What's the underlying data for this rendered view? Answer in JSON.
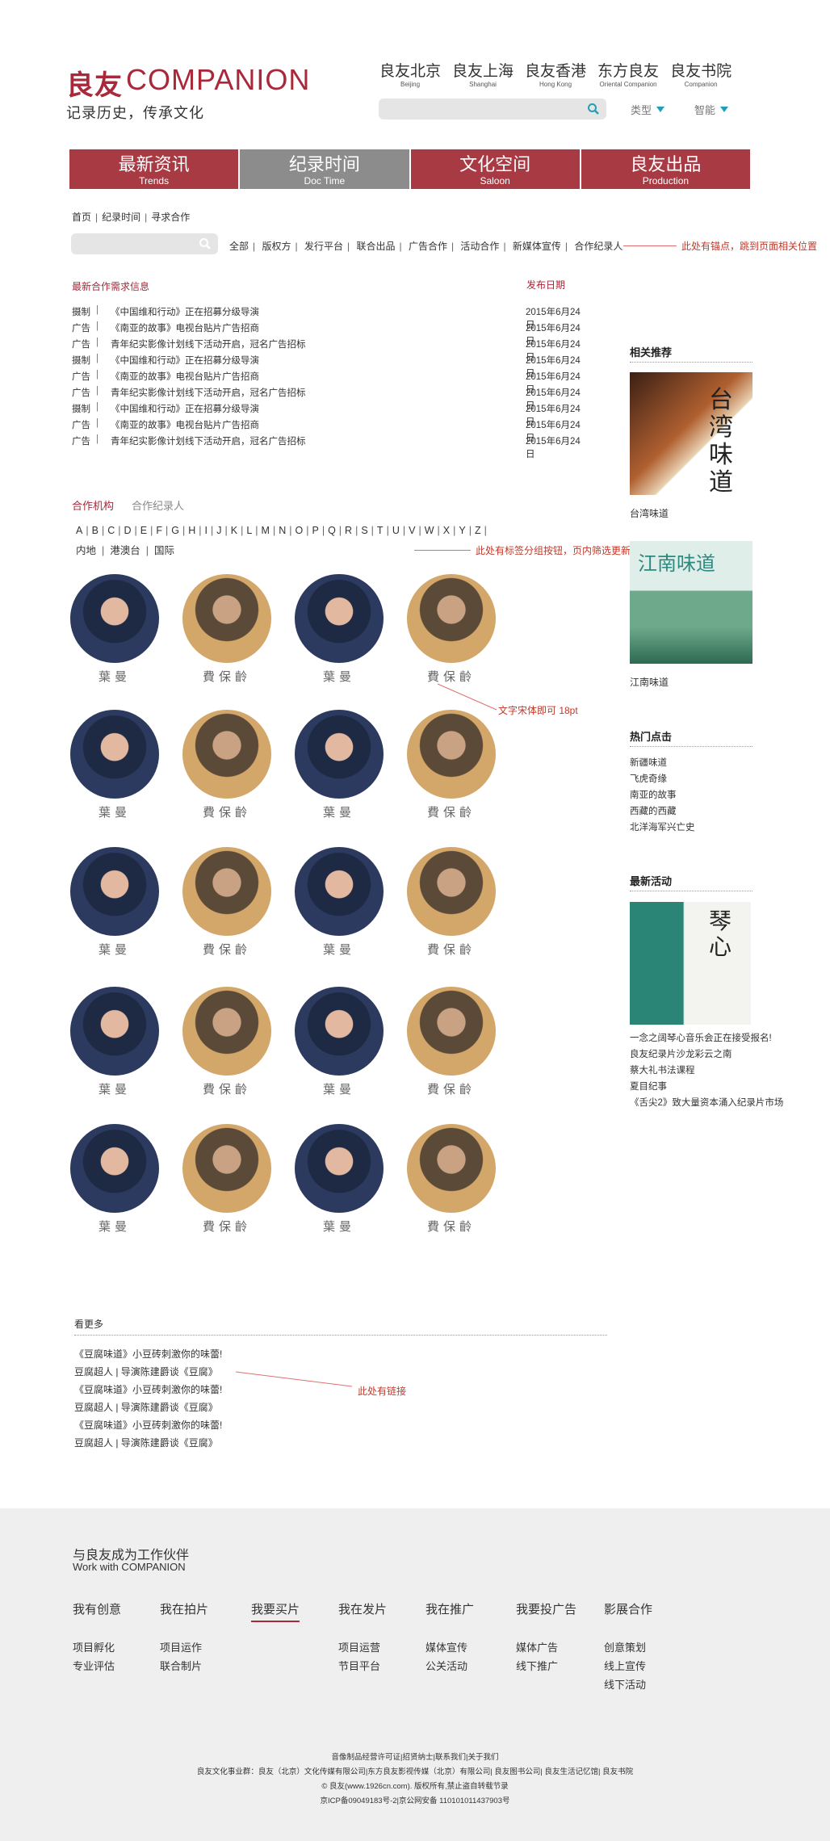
{
  "header": {
    "logo_cn": "良友",
    "logo_en": "COMPANION",
    "slogan": "记录历史，传承文化",
    "brands": [
      {
        "cn": "良友北京",
        "en": "Beijing"
      },
      {
        "cn": "良友上海",
        "en": "Shanghai"
      },
      {
        "cn": "良友香港",
        "en": "Hong Kong"
      },
      {
        "cn": "东方良友",
        "en": "Oriental Companion"
      },
      {
        "cn": "良友书院",
        "en": "Companion"
      }
    ],
    "search_placeholder": "",
    "filter_type": "类型",
    "filter_smart": "智能"
  },
  "nav": [
    {
      "cn": "最新资讯",
      "en": "Trends"
    },
    {
      "cn": "纪录时间",
      "en": "Doc Time"
    },
    {
      "cn": "文化空间",
      "en": "Saloon"
    },
    {
      "cn": "良友出品",
      "en": "Production"
    }
  ],
  "breadcrumb": [
    "首页",
    "纪录时间",
    "寻求合作"
  ],
  "categories": [
    "全部",
    "版权方",
    "发行平台",
    "联合出品",
    "广告合作",
    "活动合作",
    "新媒体宣传",
    "合作纪录人"
  ],
  "notes": {
    "anchor": "此处有锚点，跳到页面相关位置",
    "tags": "此处有标签分组按钮，页内筛选更新",
    "font": "文字宋体即可 18pt",
    "links": "此处有链接"
  },
  "info_list": {
    "heading": "最新合作需求信息",
    "date_heading": "发布日期",
    "rows": [
      {
        "type": "摄制",
        "title": "《中国维和行动》正在招募分级导演",
        "date": "2015年6月24日"
      },
      {
        "type": "广告",
        "title": "《南亚的故事》电视台贴片广告招商",
        "date": "2015年6月24日"
      },
      {
        "type": "广告",
        "title": "青年纪实影像计划线下活动开启，冠名广告招标",
        "date": "2015年6月24日"
      },
      {
        "type": "摄制",
        "title": "《中国维和行动》正在招募分级导演",
        "date": "2015年6月24日"
      },
      {
        "type": "广告",
        "title": "《南亚的故事》电视台贴片广告招商",
        "date": "2015年6月24日"
      },
      {
        "type": "广告",
        "title": "青年纪实影像计划线下活动开启，冠名广告招标",
        "date": "2015年6月24日"
      },
      {
        "type": "摄制",
        "title": "《中国维和行动》正在招募分级导演",
        "date": "2015年6月24日"
      },
      {
        "type": "广告",
        "title": "《南亚的故事》电视台贴片广告招商",
        "date": "2015年6月24日"
      },
      {
        "type": "广告",
        "title": "青年纪实影像计划线下活动开启，冠名广告招标",
        "date": "2015年6月24日"
      }
    ]
  },
  "tabs": [
    "合作机构",
    "合作纪录人"
  ],
  "alphabet": [
    "A",
    "B",
    "C",
    "D",
    "E",
    "F",
    "G",
    "H",
    "I",
    "J",
    "K",
    "L",
    "M",
    "N",
    "O",
    "P",
    "Q",
    "R",
    "S",
    "T",
    "U",
    "V",
    "W",
    "X",
    "Y",
    "Z"
  ],
  "regions": [
    "内地",
    "港澳台",
    "国际"
  ],
  "people": [
    {
      "name": "葉曼",
      "kind": "f"
    },
    {
      "name": "費保齡",
      "kind": "m"
    },
    {
      "name": "葉曼",
      "kind": "f"
    },
    {
      "name": "費保齡",
      "kind": "m"
    },
    {
      "name": "葉曼",
      "kind": "f"
    },
    {
      "name": "費保齡",
      "kind": "m"
    },
    {
      "name": "葉曼",
      "kind": "f"
    },
    {
      "name": "費保齡",
      "kind": "m"
    },
    {
      "name": "葉曼",
      "kind": "f"
    },
    {
      "name": "費保齡",
      "kind": "m"
    },
    {
      "name": "葉曼",
      "kind": "f"
    },
    {
      "name": "費保齡",
      "kind": "m"
    },
    {
      "name": "葉曼",
      "kind": "f"
    },
    {
      "name": "費保齡",
      "kind": "m"
    },
    {
      "name": "葉曼",
      "kind": "f"
    },
    {
      "name": "費保齡",
      "kind": "m"
    },
    {
      "name": "葉曼",
      "kind": "f"
    },
    {
      "name": "費保齡",
      "kind": "m"
    },
    {
      "name": "葉曼",
      "kind": "f"
    },
    {
      "name": "費保齡",
      "kind": "m"
    }
  ],
  "sidebar": {
    "related_heading": "相关推荐",
    "related": [
      {
        "caption": "台湾味道",
        "image_text": "台湾味道"
      },
      {
        "caption": "江南味道",
        "image_text": "江南味道"
      }
    ],
    "hot_heading": "热门点击",
    "hot": [
      "新疆味道",
      "飞虎奇缘",
      "南亚的故事",
      "西藏的西藏",
      "北洋海军兴亡史"
    ],
    "events_heading": "最新活动",
    "event_image_text": "琴心",
    "events": [
      "一念之阔琴心音乐会正在接受报名!",
      "良友纪录片沙龙彩云之南",
      "蔡大礼书法课程",
      "夏目纪事",
      "《舌尖2》致大量资本涌入纪录片市场"
    ]
  },
  "more": {
    "heading": "看更多",
    "items": [
      "《豆腐味道》小豆砖刺激你的味蕾!",
      "豆腐超人 | 导演陈建爵谈《豆腐》",
      "《豆腐味道》小豆砖刺激你的味蕾!",
      "豆腐超人 | 导演陈建爵谈《豆腐》",
      "《豆腐味道》小豆砖刺激你的味蕾!",
      "豆腐超人 | 导演陈建爵谈《豆腐》"
    ]
  },
  "footer": {
    "partner_cn": "与良友成为工作伙伴",
    "partner_en": "Work with COMPANION",
    "columns": [
      {
        "heading": "我有创意",
        "items": [
          "项目孵化",
          "专业评估"
        ]
      },
      {
        "heading": "我在拍片",
        "items": [
          "项目运作",
          "联合制片"
        ]
      },
      {
        "heading": "我要买片",
        "items": []
      },
      {
        "heading": "我在发片",
        "items": [
          "项目运营",
          "节目平台"
        ]
      },
      {
        "heading": "我在推广",
        "items": [
          "媒体宣传",
          "公关活动"
        ]
      },
      {
        "heading": "我要投广告",
        "items": [
          "媒体广告",
          "线下推广"
        ]
      },
      {
        "heading": "影展合作",
        "items": [
          "创意策划",
          "线上宣传",
          "线下活动"
        ]
      }
    ],
    "legal": [
      "音像制品经营许可证|招贤纳士|联系我们|关于我们",
      "良友文化事业群：良友（北京）文化传媒有限公司|东方良友影视传媒（北京）有限公司| 良友图书公司| 良友生活记忆馆| 良友书院",
      "© 良友(www.1926cn.com). 版权所有,禁止盗自转载节录",
      "京ICP备09049183号-2|京公网安备 110101011437903号"
    ]
  },
  "colors": {
    "brand": "#a8293a",
    "nav_active": "#8c8c8c",
    "accent": "#1fa0b8",
    "note": "#c0392b"
  }
}
